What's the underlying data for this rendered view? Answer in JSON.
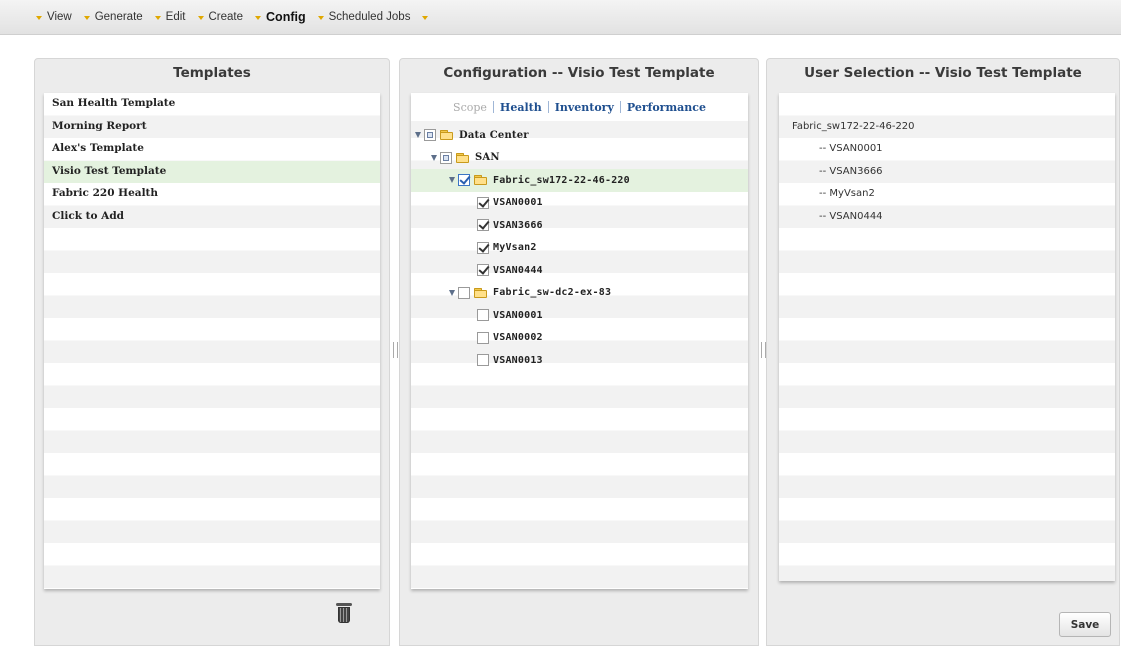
{
  "menu": {
    "items": [
      {
        "label": "View",
        "active": false
      },
      {
        "label": "Generate",
        "active": false
      },
      {
        "label": "Edit",
        "active": false
      },
      {
        "label": "Create",
        "active": false
      },
      {
        "label": "Config",
        "active": true
      },
      {
        "label": "Scheduled Jobs",
        "active": false
      }
    ]
  },
  "templates": {
    "title": "Templates",
    "items": [
      {
        "label": "San Health Template"
      },
      {
        "label": "Morning Report"
      },
      {
        "label": "Alex's Template"
      },
      {
        "label": "Visio Test Template",
        "selected": true
      },
      {
        "label": "Fabric 220 Health"
      },
      {
        "label": "Click to Add"
      }
    ]
  },
  "configuration": {
    "title": "Configuration -- Visio Test Template",
    "tabs": [
      {
        "label": "Scope",
        "active": false
      },
      {
        "label": "Health",
        "active": true
      },
      {
        "label": "Inventory",
        "active": true
      },
      {
        "label": "Performance",
        "active": true
      }
    ],
    "tree": [
      {
        "label": "Data Center",
        "state": "partial",
        "folder": true,
        "expander": true
      },
      {
        "label": "SAN",
        "state": "partial",
        "folder": true,
        "expander": true
      },
      {
        "label": "Fabric_sw172-22-46-220",
        "state": "checked",
        "folder": true,
        "expander": true,
        "selected": true
      },
      {
        "label": "VSAN0001",
        "state": "checked"
      },
      {
        "label": "VSAN3666",
        "state": "checked"
      },
      {
        "label": "MyVsan2",
        "state": "checked"
      },
      {
        "label": "VSAN0444",
        "state": "checked"
      },
      {
        "label": "Fabric_sw-dc2-ex-83",
        "state": "unchecked",
        "folder": true,
        "expander": true
      },
      {
        "label": "VSAN0001",
        "state": "unchecked"
      },
      {
        "label": "VSAN0002",
        "state": "unchecked"
      },
      {
        "label": "VSAN0013",
        "state": "unchecked"
      }
    ]
  },
  "user_selection": {
    "title": "User Selection -- Visio Test Template",
    "items": [
      {
        "label": "Fabric_sw172-22-46-220"
      },
      {
        "label": "-- VSAN0001"
      },
      {
        "label": "-- VSAN3666"
      },
      {
        "label": "-- MyVsan2"
      },
      {
        "label": "-- VSAN0444"
      }
    ],
    "save_label": "Save"
  },
  "icons": {
    "trash": "trash-icon",
    "folder": "folder-icon",
    "expander": "expand-triangle-icon"
  },
  "colors": {
    "selected_row": "#e4f2df",
    "tab_link": "#1f4f8f",
    "menu_bullet": "#e0a800"
  }
}
